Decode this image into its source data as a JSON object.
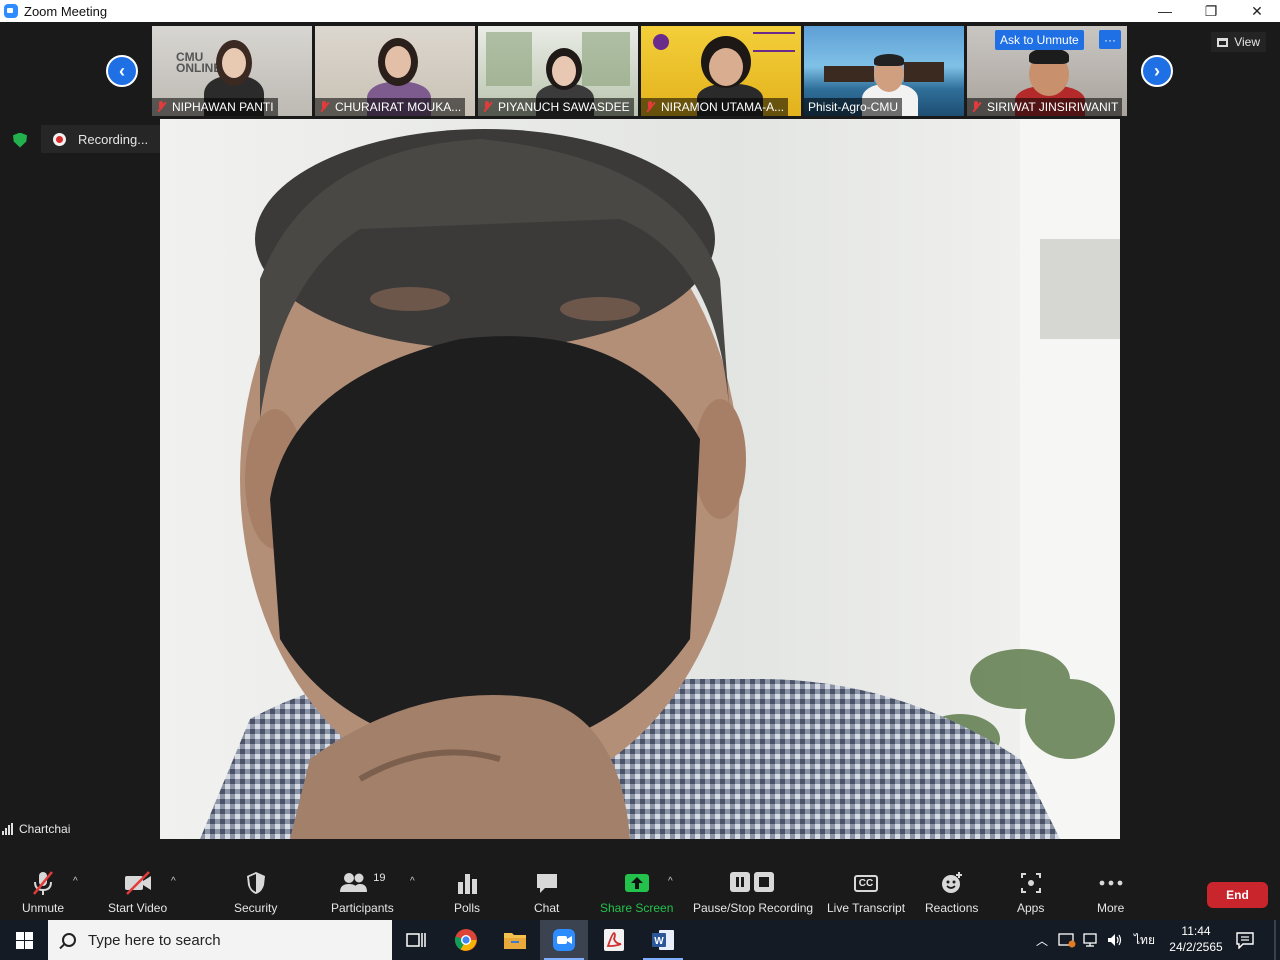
{
  "window": {
    "title": "Zoom Meeting",
    "minimize": "—",
    "restore": "❐",
    "close": "✕"
  },
  "gallery": {
    "prev_glyph": "‹",
    "next_glyph": "›",
    "participants": [
      {
        "name": "NIPHAWAN PANTI",
        "muted": true,
        "bg_text": "CMU\nONLINE"
      },
      {
        "name": "CHURAIRAT MOUKA...",
        "muted": true
      },
      {
        "name": "PIYANUCH SAWASDEE",
        "muted": true
      },
      {
        "name": "NIRAMON UTAMA-A...",
        "muted": true
      },
      {
        "name": "Phisit-Agro-CMU",
        "muted": false
      },
      {
        "name": "SIRIWAT JINSIRIWANIT",
        "muted": true,
        "hover_button": "Ask to Unmute",
        "more": "···"
      }
    ],
    "view_label": "View"
  },
  "recording": {
    "status": "Recording...",
    "security_verified": true
  },
  "active_speaker": {
    "name": "Chartchai"
  },
  "toolbar": {
    "unmute": "Unmute",
    "start_video": "Start Video",
    "security": "Security",
    "participants": "Participants",
    "participants_count": "19",
    "polls": "Polls",
    "chat": "Chat",
    "share_screen": "Share Screen",
    "pause_stop_recording": "Pause/Stop Recording",
    "live_transcript": "Live Transcript",
    "cc_glyph": "CC",
    "reactions": "Reactions",
    "apps": "Apps",
    "more": "More",
    "end": "End",
    "caret": "^"
  },
  "taskbar": {
    "search_placeholder": "Type here to search",
    "language": "ไทย",
    "time": "11:44",
    "date": "24/2/2565",
    "word_glyph": "W"
  },
  "colors": {
    "accent_blue": "#1f6fe5",
    "share_green": "#23c24d",
    "end_red": "#c8252c",
    "recording_red": "#d92c2c"
  }
}
